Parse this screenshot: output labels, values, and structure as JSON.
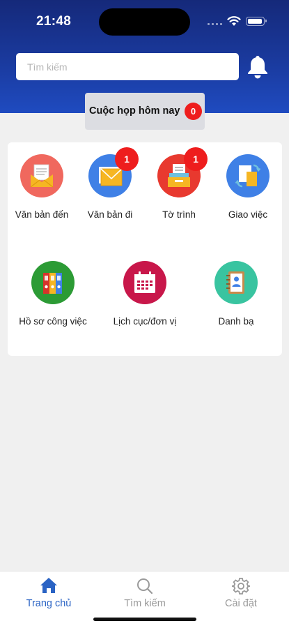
{
  "status": {
    "time": "21:48"
  },
  "search": {
    "placeholder": "Tìm kiếm"
  },
  "meeting": {
    "label": "Cuộc họp hôm nay",
    "count": "0"
  },
  "tiles": [
    {
      "label": "Văn bản đến",
      "icon": "inbox-envelope-icon"
    },
    {
      "label": "Văn bản đi",
      "icon": "outgoing-mail-icon",
      "badge": "1"
    },
    {
      "label": "Tờ trình",
      "icon": "submission-tray-icon",
      "badge": "1"
    },
    {
      "label": "Giao việc",
      "icon": "task-assign-icon"
    },
    {
      "label": "Hồ sơ công việc",
      "icon": "binders-icon"
    },
    {
      "label": "Lịch cục/đơn vị",
      "icon": "calendar-icon"
    },
    {
      "label": "Danh bạ",
      "icon": "contact-book-icon"
    }
  ],
  "tabs": [
    {
      "label": "Trang chủ",
      "icon": "home-icon",
      "active": true
    },
    {
      "label": "Tìm kiếm",
      "icon": "search-icon",
      "active": false
    },
    {
      "label": "Cài đặt",
      "icon": "gear-icon",
      "active": false
    }
  ],
  "colors": {
    "header_top": "#15297a",
    "header_bottom": "#1f4bc0",
    "badge": "#ee1d1d",
    "active_tab": "#2a63c4",
    "inactive_tab": "#9a9a9a"
  }
}
